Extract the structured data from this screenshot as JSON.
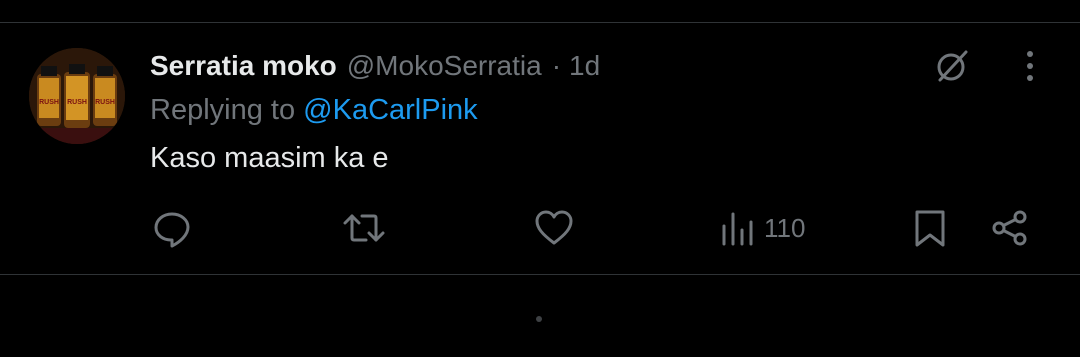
{
  "tweet": {
    "display_name": "Serratia moko",
    "handle": "@MokoSerratia",
    "separator": "·",
    "time": "1d",
    "replying_to_prefix": "Replying to",
    "replying_to_handle": "@KaCarlPink",
    "text": "Kaso maasim ka e",
    "avatar_bottle_labels": [
      "RUSH",
      "RUSH",
      "RUSH"
    ]
  },
  "actions": {
    "reply_icon": "speech-bubble-icon",
    "retweet_icon": "repost-icon",
    "like_icon": "heart-icon",
    "views_icon": "bar-chart-icon",
    "views_count": "110",
    "bookmark_icon": "bookmark-icon",
    "share_icon": "share-icon"
  },
  "header_icons": {
    "grok": "grok-slash-circle-icon",
    "more": "vertical-ellipsis-icon"
  },
  "colors": {
    "background": "#000000",
    "primary_text": "#e7e9ea",
    "secondary_text": "#71767b",
    "accent": "#1d9bf0",
    "divider": "#2f3336"
  }
}
